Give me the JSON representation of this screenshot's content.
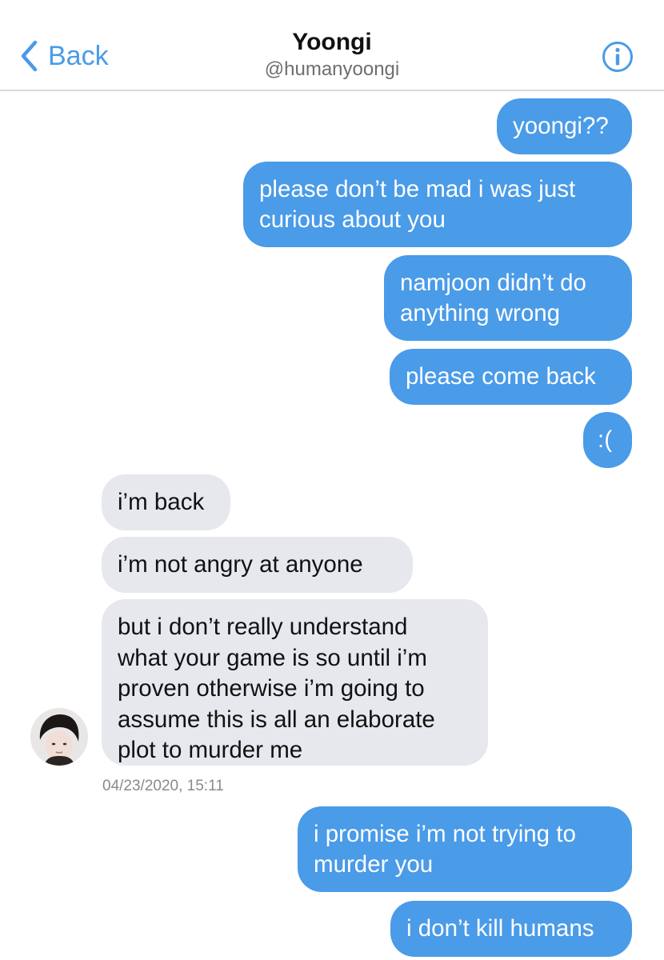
{
  "header": {
    "back_label": "Back",
    "title": "Yoongi",
    "handle": "@humanyoongi",
    "icons": {
      "back": "chevron-left-icon",
      "info": "info-icon"
    },
    "accent_color": "#4a9be8"
  },
  "messages": [
    {
      "from": "me",
      "lines": [
        "yoongi??"
      ]
    },
    {
      "from": "me",
      "lines": [
        "please don’t be mad i was just",
        "curious about you"
      ]
    },
    {
      "from": "me",
      "lines": [
        "namjoon didn’t do",
        "anything wrong"
      ]
    },
    {
      "from": "me",
      "lines": [
        "please come back"
      ]
    },
    {
      "from": "me",
      "lines": [
        ":("
      ]
    },
    {
      "from": "them",
      "lines": [
        "i’m back"
      ]
    },
    {
      "from": "them",
      "lines": [
        "i’m not angry at anyone"
      ]
    },
    {
      "from": "them",
      "lines": [
        "but i don’t really understand",
        "what your game is so until i’m",
        "proven otherwise i’m going to",
        "assume this is all an elaborate",
        "plot to murder me"
      ]
    },
    {
      "from": "me",
      "lines": [
        "i promise i’m not trying to",
        "murder you"
      ]
    },
    {
      "from": "me",
      "lines": [
        "i don’t kill humans"
      ]
    }
  ],
  "timestamp": "04/23/2020, 15:11",
  "colors": {
    "outgoing": "#4a9be8",
    "incoming": "#e6e8ed"
  }
}
